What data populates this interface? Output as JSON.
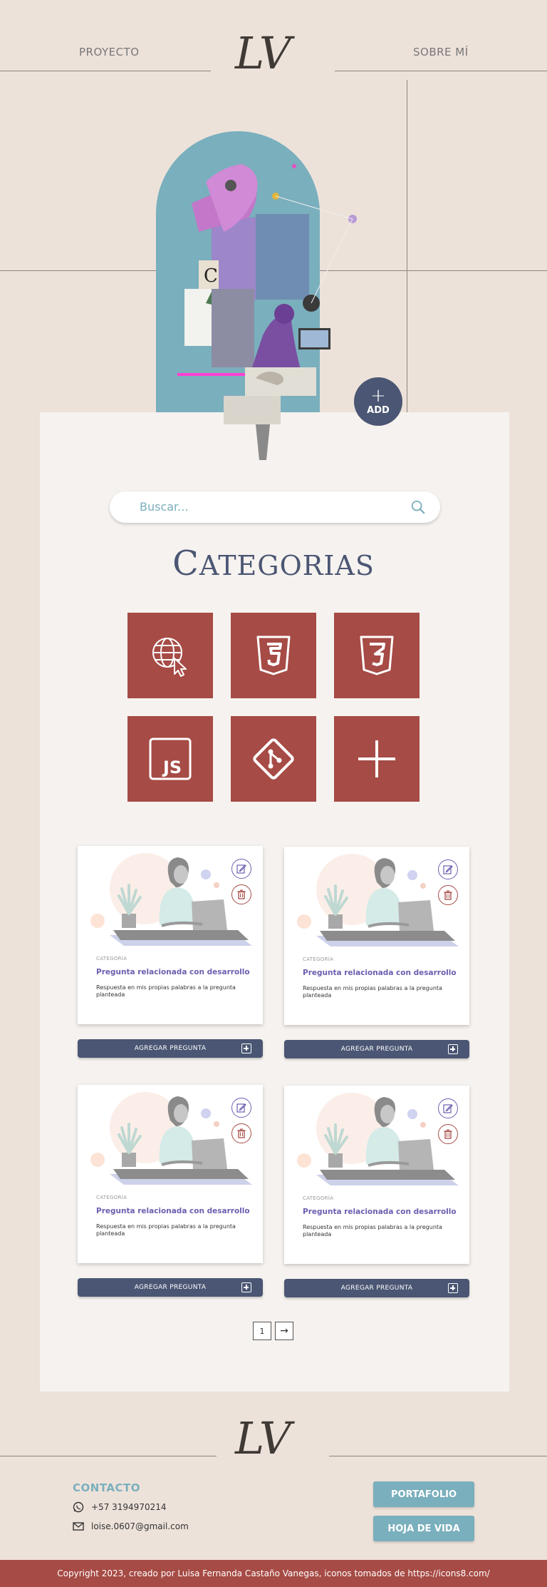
{
  "header": {
    "nav_left": "PROYECTO",
    "nav_right": "SOBRE MÍ",
    "logo": "LV"
  },
  "hero": {
    "add_plus": "+",
    "add_label": "ADD"
  },
  "search": {
    "placeholder": "Buscar..."
  },
  "categories": {
    "title_first": "C",
    "title_rest": "ATEGORIAS",
    "items": [
      {
        "icon": "web-cursor-icon"
      },
      {
        "icon": "html5-icon"
      },
      {
        "icon": "css3-icon"
      },
      {
        "icon": "javascript-icon"
      },
      {
        "icon": "git-icon"
      },
      {
        "icon": "plus-icon"
      }
    ]
  },
  "cards": [
    {
      "category": "CATEGORÍA",
      "question": "Pregunta relacionada con desarrollo",
      "answer": "Respuesta en mis propias palabras a la pregunta planteada",
      "button": "AGREGAR PREGUNTA"
    },
    {
      "category": "CATEGORÍA",
      "question": "Pregunta relacionada con desarrollo",
      "answer": "Respuesta en mis propias palabras a la pregunta planteada",
      "button": "AGREGAR PREGUNTA"
    },
    {
      "category": "CATEGORÍA",
      "question": "Pregunta relacionada con desarrollo",
      "answer": "Respuesta en mis propias palabras a la pregunta planteada",
      "button": "AGREGAR PREGUNTA"
    },
    {
      "category": "CATEGORÍA",
      "question": "Pregunta relacionada con desarrollo",
      "answer": "Respuesta en mis propias palabras a la pregunta planteada",
      "button": "AGREGAR PREGUNTA"
    }
  ],
  "pagination": {
    "current": "1",
    "next": "→"
  },
  "footer": {
    "logo": "LV",
    "contact_title": "CONTACTO",
    "phone": "+57 3194970214",
    "email": "loise.0607@gmail.com",
    "btn_portfolio": "PORTAFOLIO",
    "btn_cv": "HOJA DE VIDA",
    "copyright": "Copyright 2023, creado por Luisa Fernanda Castaño Vanegas, iconos tomados de https://icons8.com/"
  },
  "colors": {
    "background": "#ede2da",
    "panel": "#f6f2ef",
    "accent_red": "#a64b45",
    "navy": "#4a5673",
    "teal": "#7aafbd",
    "purple": "#6b5fb0"
  }
}
